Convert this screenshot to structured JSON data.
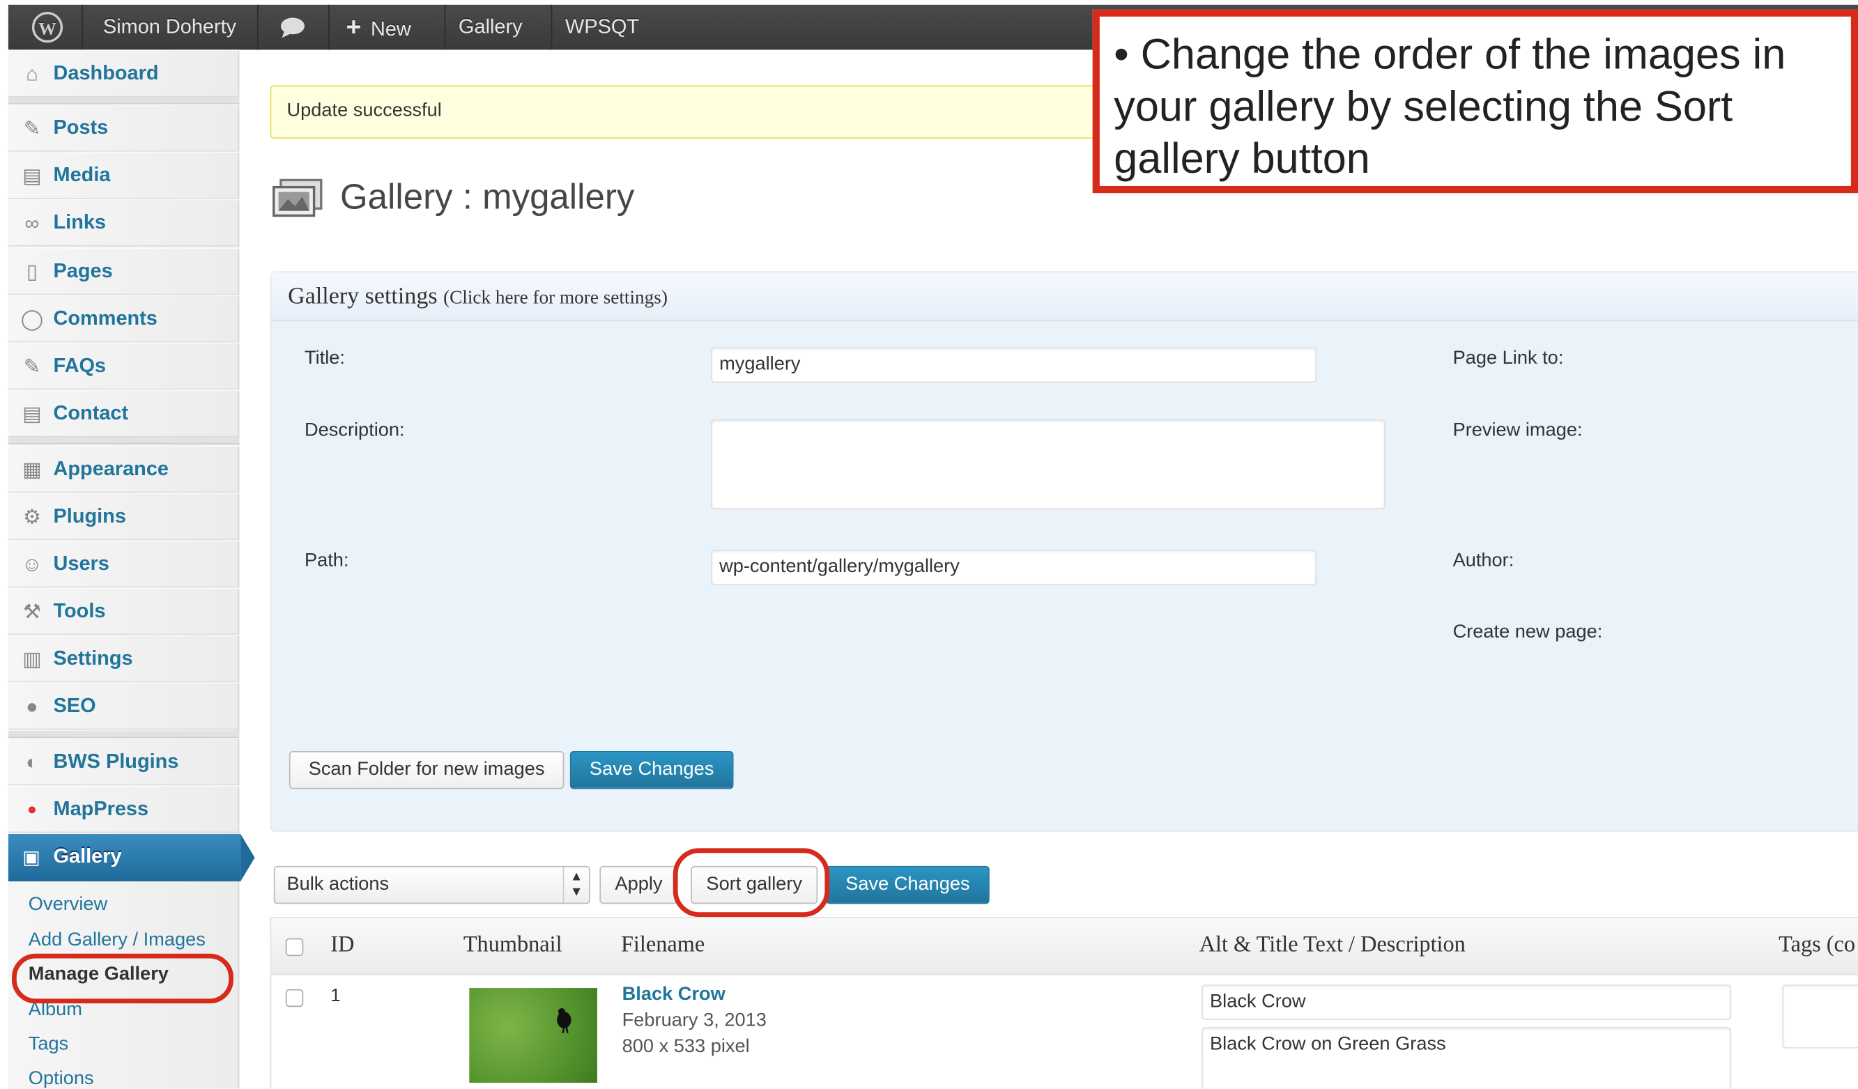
{
  "admin_bar": {
    "wp_logo": "wordpress-logo",
    "user": "Simon Doherty",
    "comments_icon": "speech-bubble-icon",
    "new_label": "New",
    "gallery": "Gallery",
    "wpsqt": "WPSQT"
  },
  "sidebar": {
    "items": [
      {
        "label": "Dashboard",
        "icon": "home-icon"
      },
      {
        "label": "Posts",
        "icon": "pin-icon"
      },
      {
        "label": "Media",
        "icon": "media-icon"
      },
      {
        "label": "Links",
        "icon": "link-icon"
      },
      {
        "label": "Pages",
        "icon": "pages-icon"
      },
      {
        "label": "Comments",
        "icon": "comment-icon"
      },
      {
        "label": "FAQs",
        "icon": "pin-icon"
      },
      {
        "label": "Contact",
        "icon": "contact-icon"
      },
      {
        "label": "Appearance",
        "icon": "appearance-icon"
      },
      {
        "label": "Plugins",
        "icon": "plugin-icon"
      },
      {
        "label": "Users",
        "icon": "users-icon"
      },
      {
        "label": "Tools",
        "icon": "tools-icon"
      },
      {
        "label": "Settings",
        "icon": "settings-icon"
      },
      {
        "label": "SEO",
        "icon": "seo-icon"
      },
      {
        "label": "BWS Plugins",
        "icon": "bws-icon"
      },
      {
        "label": "MapPress",
        "icon": "map-pin-icon"
      }
    ],
    "active": {
      "label": "Gallery",
      "icon": "gallery-icon"
    },
    "submenu": [
      "Overview",
      "Add Gallery / Images",
      "Manage Gallery",
      "Album",
      "Tags",
      "Options"
    ]
  },
  "notice": "Update successful",
  "page_title": "Gallery : mygallery",
  "settings": {
    "heading": "Gallery settings",
    "heading_link": "(Click here for more settings)",
    "title_label": "Title:",
    "title_value": "mygallery",
    "description_label": "Description:",
    "description_value": "",
    "path_label": "Path:",
    "path_value": "wp-content/gallery/mygallery",
    "page_link_label": "Page Link to:",
    "preview_label": "Preview image:",
    "author_label": "Author:",
    "create_page_label": "Create new page:",
    "scan_button": "Scan Folder for new images",
    "save_button": "Save Changes"
  },
  "toolbar": {
    "bulk_actions": "Bulk actions",
    "apply": "Apply",
    "sort_gallery": "Sort gallery",
    "save_changes": "Save Changes"
  },
  "table": {
    "headers": [
      "ID",
      "Thumbnail",
      "Filename",
      "Alt & Title Text / Description",
      "Tags (co"
    ],
    "rows": [
      {
        "id": "1",
        "filename": "Black Crow",
        "date": "February 3, 2013",
        "size": "800 x 533 pixel",
        "alt_title": "Black Crow",
        "description": "Black Crow on Green Grass"
      }
    ]
  },
  "callout": "• Change the order of the images in your gallery by selecting the Sort gallery button",
  "colors": {
    "accent": "#21759b",
    "highlight": "#d62a1a",
    "notice_bg": "#ffffe0"
  }
}
